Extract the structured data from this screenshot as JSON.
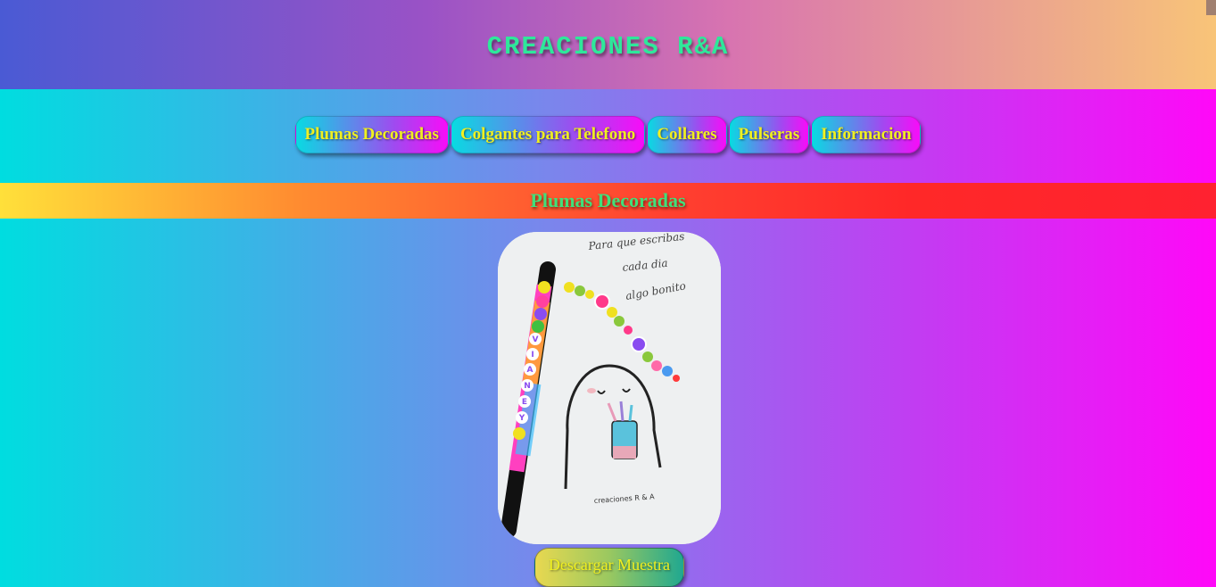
{
  "header": {
    "title": "CREACIONES R&A"
  },
  "nav": {
    "items": [
      {
        "label": "Plumas Decoradas"
      },
      {
        "label": "Colgantes para Telefono"
      },
      {
        "label": "Collares"
      },
      {
        "label": "Pulseras"
      },
      {
        "label": "Informacion"
      }
    ]
  },
  "section": {
    "title": "Plumas Decoradas"
  },
  "product": {
    "image_text": {
      "line1": "Para que escribas",
      "line2": "cada dia",
      "line3": "algo bonito",
      "caption": "creaciones R & A",
      "pen_letters": [
        "V",
        "I",
        "A",
        "N",
        "E",
        "Y"
      ]
    },
    "download_label": "Descargar Muestra"
  },
  "colors": {
    "title": "#2ee89a",
    "nav_text": "#f0f020",
    "section_title": "#40e07a"
  }
}
